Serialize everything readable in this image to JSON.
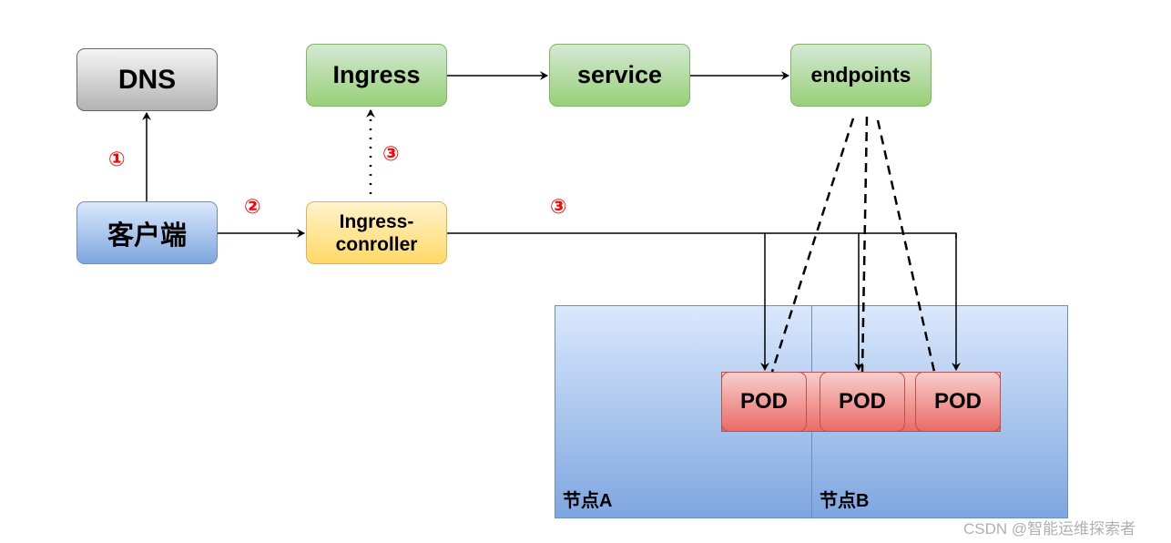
{
  "nodes": {
    "dns": "DNS",
    "ingress": "Ingress",
    "service": "service",
    "endpoints": "endpoints",
    "client": "客户端",
    "ingress_controller_line1": "Ingress-",
    "ingress_controller_line2": "conroller"
  },
  "worker_nodes": {
    "node_a": "节点A",
    "node_b": "节点B"
  },
  "pods": [
    "POD",
    "POD",
    "POD"
  ],
  "steps": {
    "dns_lookup": "①",
    "to_controller": "②",
    "watch_ingress": "③",
    "forward_to_pods": "③"
  },
  "colors": {
    "step_text": "#ff0000",
    "green_fill": "#d5e8d4",
    "green_border": "#82b366",
    "blue_fill": "#dae8fc",
    "blue_border": "#6c8ebf",
    "yellow_fill": "#fff2cc",
    "yellow_border": "#d6b656",
    "red_fill": "#f8cecc",
    "red_border": "#b85450",
    "gray_fill": "#f5f5f5",
    "gray_border": "#666666"
  },
  "edges": [
    {
      "from": "client",
      "to": "dns",
      "style": "solid"
    },
    {
      "from": "client",
      "to": "ingress-controller",
      "style": "solid"
    },
    {
      "from": "ingress-controller",
      "to": "ingress",
      "style": "dotted"
    },
    {
      "from": "ingress",
      "to": "service",
      "style": "solid"
    },
    {
      "from": "service",
      "to": "endpoints",
      "style": "solid"
    },
    {
      "from": "ingress-controller",
      "to": "pod-1",
      "style": "solid"
    },
    {
      "from": "ingress-controller",
      "to": "pod-2",
      "style": "solid"
    },
    {
      "from": "ingress-controller",
      "to": "pod-3",
      "style": "solid"
    },
    {
      "from": "endpoints",
      "to": "pod-1",
      "style": "dashed"
    },
    {
      "from": "endpoints",
      "to": "pod-2",
      "style": "dashed"
    },
    {
      "from": "endpoints",
      "to": "pod-3",
      "style": "dashed"
    }
  ],
  "watermark": "CSDN @智能运维探索者"
}
